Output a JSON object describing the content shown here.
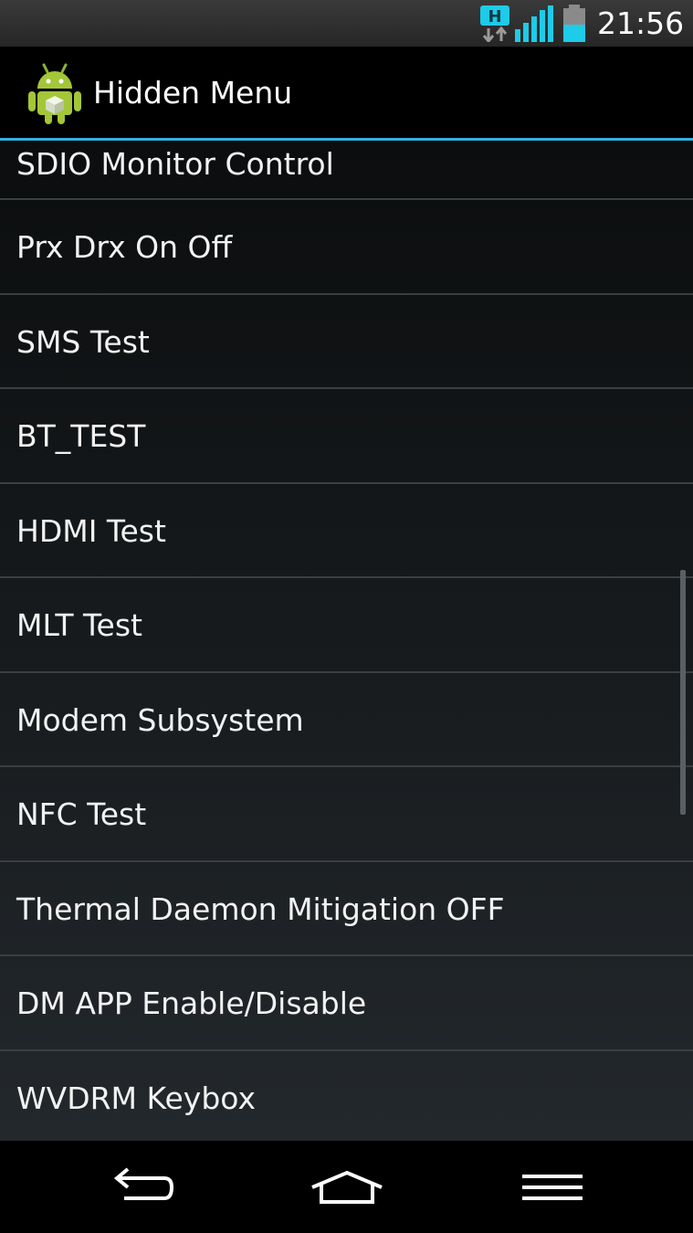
{
  "status_bar": {
    "network_type": "H",
    "signal_icon": "signal-bars-icon",
    "battery_icon": "battery-icon",
    "time": "21:56"
  },
  "action_bar": {
    "app_icon": "android-app-icon",
    "title": "Hidden Menu"
  },
  "menu": {
    "items": [
      {
        "label": "SDIO Monitor Control"
      },
      {
        "label": "Prx Drx On Off"
      },
      {
        "label": "SMS Test"
      },
      {
        "label": "BT_TEST"
      },
      {
        "label": "HDMI Test"
      },
      {
        "label": "MLT Test"
      },
      {
        "label": "Modem Subsystem"
      },
      {
        "label": "NFC Test"
      },
      {
        "label": "Thermal Daemon Mitigation OFF"
      },
      {
        "label": "DM APP Enable/Disable"
      },
      {
        "label": "WVDRM Keybox"
      }
    ]
  },
  "nav_bar": {
    "back_icon": "back-arrow-icon",
    "home_icon": "home-icon",
    "menu_icon": "menu-icon"
  },
  "colors": {
    "accent": "#34b0de",
    "status_cyan": "#1ecbe8",
    "android_green": "#a4c639"
  }
}
